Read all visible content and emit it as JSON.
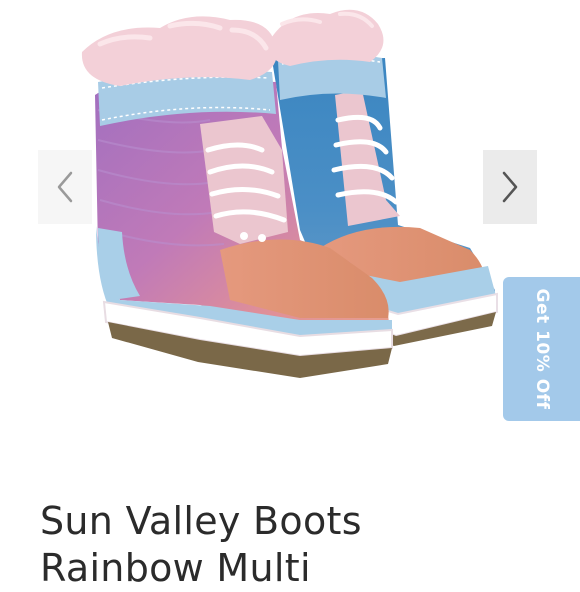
{
  "product": {
    "title_line1": "Sun Valley Boots",
    "title_line2": "Rainbow Multi",
    "image_icon": "baby-snow-boots-photo"
  },
  "gallery": {
    "prev_icon": "chevron-left-icon",
    "next_icon": "chevron-right-icon"
  },
  "promo": {
    "label": "Get 10% Off"
  },
  "colors": {
    "promo_bg": "#a3c9ea",
    "title_text": "#2b2b2b",
    "arrow": "#9a9a9a"
  }
}
